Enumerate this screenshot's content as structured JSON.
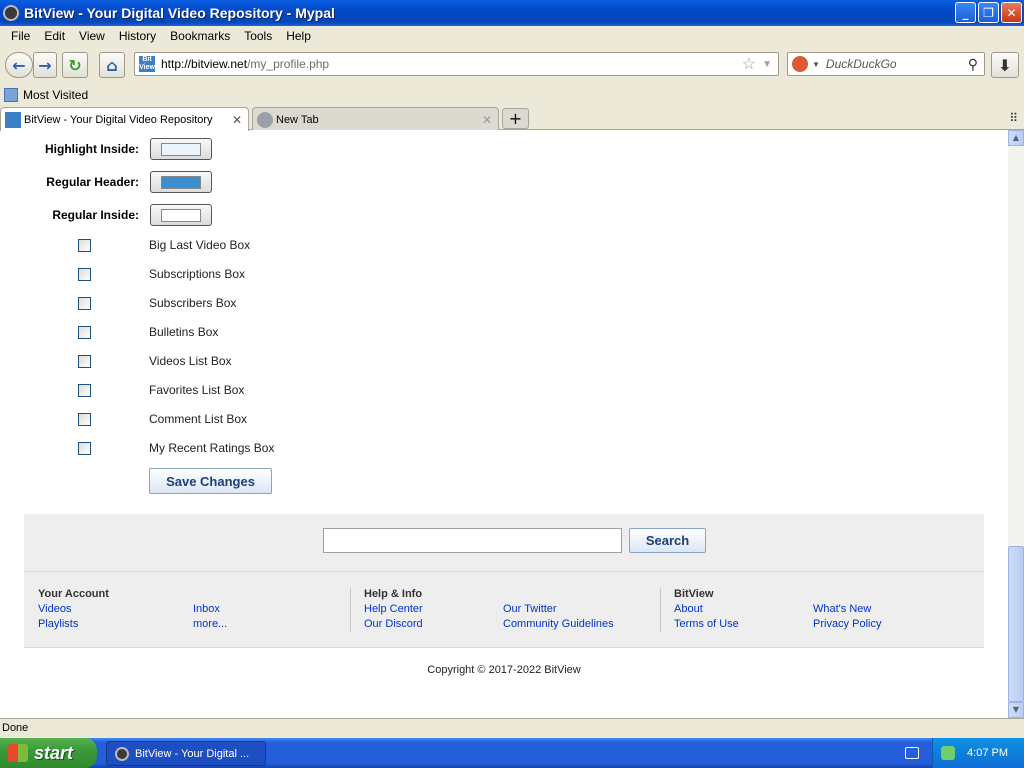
{
  "window": {
    "title": "BitView - Your Digital Video Repository - Mypal",
    "minimize": "_",
    "maximize": "❐",
    "close": "✕"
  },
  "menu": [
    "File",
    "Edit",
    "View",
    "History",
    "Bookmarks",
    "Tools",
    "Help"
  ],
  "nav": {
    "url_host": "http://bitview.net",
    "url_path": "/my_profile.php",
    "search_placeholder": "DuckDuckGo"
  },
  "bookmarks": {
    "most_visited": "Most Visited"
  },
  "tabs": [
    {
      "label": "BitView - Your Digital Video Repository",
      "active": true
    },
    {
      "label": "New Tab",
      "active": false
    }
  ],
  "settings": {
    "color_rows": [
      {
        "label": "Highlight Inside:",
        "color": "#ecf4fc"
      },
      {
        "label": "Regular Header:",
        "color": "#3a8fd0"
      },
      {
        "label": "Regular Inside:",
        "color": "#ffffff"
      }
    ],
    "checkboxes": [
      {
        "label": "Big Last Video Box",
        "checked": false
      },
      {
        "label": "Subscriptions Box",
        "checked": false
      },
      {
        "label": "Subscribers Box",
        "checked": false
      },
      {
        "label": "Bulletins Box",
        "checked": false
      },
      {
        "label": "Videos List Box",
        "checked": false
      },
      {
        "label": "Favorites List Box",
        "checked": false
      },
      {
        "label": "Comment List Box",
        "checked": false
      },
      {
        "label": "My Recent Ratings Box",
        "checked": false
      }
    ],
    "save_label": "Save Changes"
  },
  "footer": {
    "search_button": "Search",
    "search_value": "",
    "account": {
      "heading": "Your Account",
      "links": [
        "Videos",
        "Inbox",
        "Playlists",
        "more..."
      ]
    },
    "help": {
      "heading": "Help & Info",
      "links": [
        "Help Center",
        "Our Twitter",
        "Our Discord",
        "Community Guidelines"
      ]
    },
    "bitview": {
      "heading": "BitView",
      "links": [
        "About",
        "What's New",
        "Terms of Use",
        "Privacy Policy"
      ]
    },
    "copyright": "Copyright © 2017-2022 BitView"
  },
  "status": "Done",
  "taskbar": {
    "start": "start",
    "task_label": "BitView - Your Digital ...",
    "clock": "4:07 PM"
  },
  "colors": {
    "link": "#0033cc",
    "button_text": "#1c3f7a",
    "footer_bg": "#eeeeee"
  }
}
